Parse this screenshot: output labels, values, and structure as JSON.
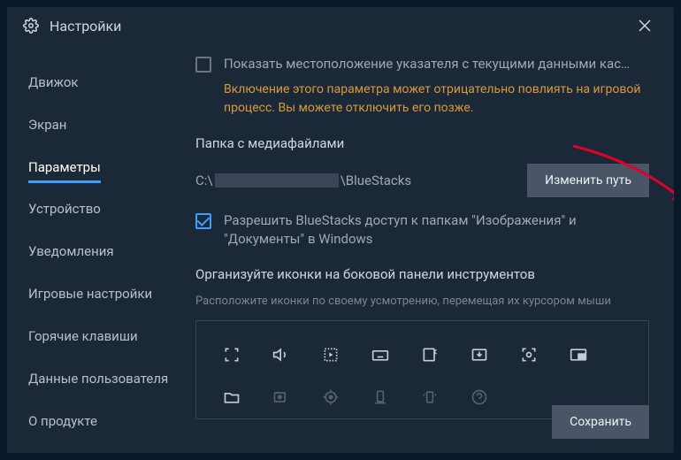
{
  "title": "Настройки",
  "sidebar": {
    "items": [
      {
        "label": "Движок"
      },
      {
        "label": "Экран"
      },
      {
        "label": "Параметры",
        "active": true
      },
      {
        "label": "Устройство"
      },
      {
        "label": "Уведомления"
      },
      {
        "label": "Игровые настройки"
      },
      {
        "label": "Горячие клавиши"
      },
      {
        "label": "Данные пользователя"
      },
      {
        "label": "О продукте"
      }
    ]
  },
  "main": {
    "pointer_checkbox_label": "Показать местоположение указателя с текущими данными кас…",
    "warning_text": "Включение этого параметра может отрицательно повлиять на игровой процесс. Вы можете отключить его позже.",
    "media_folder_title": "Папка с медиафайлами",
    "path_prefix": "C:\\",
    "path_suffix": "\\BlueStacks",
    "change_path_btn": "Изменить путь",
    "allow_access_label": "Разрешить BlueStacks доступ к папкам \"Изображения\" и \"Документы\" в Windows",
    "organize_title": "Организуйте иконки на боковой панели инструментов",
    "organize_subtitle": "Расположите иконки по своему усмотрению, перемещая их курсором мыши",
    "save_btn": "Сохранить"
  },
  "icons": {
    "row1": [
      "fullscreen",
      "volume",
      "macro",
      "keyboard",
      "install-apk",
      "screenshot",
      "camera",
      "pip",
      "folder"
    ],
    "row2": [
      "record",
      "location",
      "rotate",
      "shake",
      "more"
    ]
  }
}
